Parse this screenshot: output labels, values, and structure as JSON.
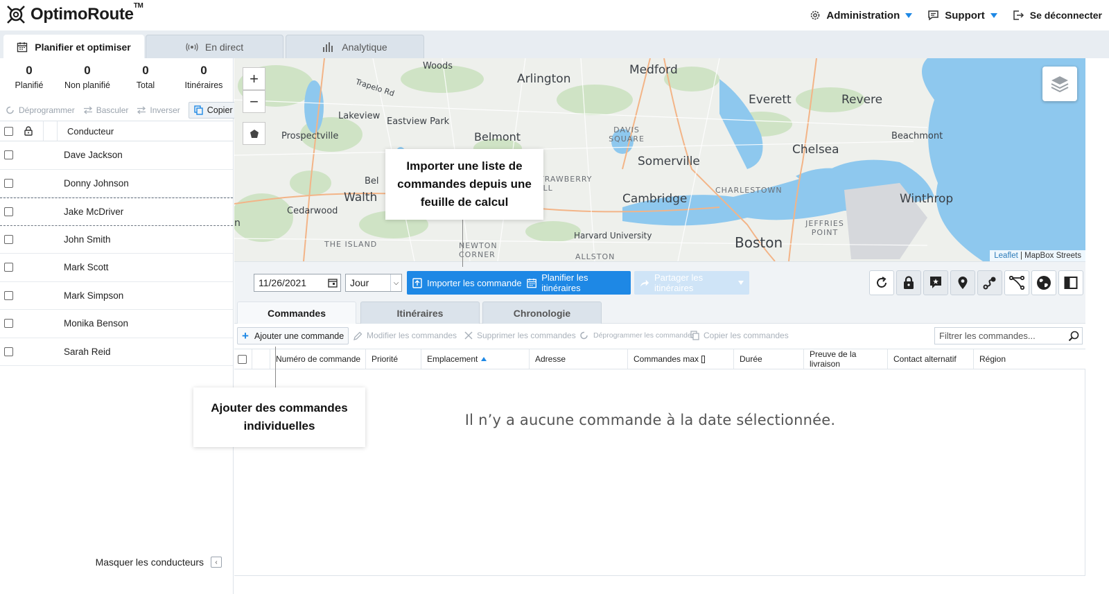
{
  "app": {
    "logo_text": "OptimoRoute",
    "logo_tm": "TM",
    "top_nav": [
      {
        "label": "Administration",
        "icon": "gear-icon",
        "dropdown": true
      },
      {
        "label": "Support",
        "icon": "chat-icon",
        "dropdown": true
      },
      {
        "label": "Se déconnecter",
        "icon": "logout-icon",
        "dropdown": false
      }
    ],
    "accent_color": "#1e88e5"
  },
  "main_tabs": [
    {
      "label": "Planifier et optimiser",
      "icon": "calendar-icon",
      "active": true
    },
    {
      "label": "En direct",
      "icon": "broadcast-icon",
      "active": false
    },
    {
      "label": "Analytique",
      "icon": "bar-chart-icon",
      "active": false
    }
  ],
  "stats": [
    {
      "value": "0",
      "label": "Planifié"
    },
    {
      "value": "0",
      "label": "Non planifié"
    },
    {
      "value": "0",
      "label": "Total"
    },
    {
      "value": "0",
      "label": "Itinéraires"
    }
  ],
  "driver_actions": {
    "unschedule": "Déprogrammer",
    "switch": "Basculer",
    "reverse": "Inverser",
    "copy": "Copier"
  },
  "drivers": {
    "column_header": "Conducteur",
    "items": [
      "Dave Jackson",
      "Donny Johnson",
      "Jake McDriver",
      "John Smith",
      "Mark Scott",
      "Mark Simpson",
      "Monika Benson",
      "Sarah Reid"
    ],
    "hide_label": "Masquer les conducteurs"
  },
  "map": {
    "labels": [
      "Arlington",
      "Medford",
      "Everett",
      "Revere",
      "Woods",
      "Lakeview",
      "Eastview Park",
      "Belmont",
      "Prospectville",
      "DAVIS SQUARE",
      "Somerville",
      "Chelsea",
      "Beachmont",
      "Walth",
      "Cedarwood",
      "STRAWBERRY HILL",
      "Cambridge",
      "CHARLESTOWN",
      "Winthrop",
      "JEFFRIES POINT",
      "Harvard University",
      "Boston",
      "THE ISLAND",
      "NEWTON CORNER",
      "ALLSTON",
      "Trapelo Rd",
      "Bel",
      "n"
    ],
    "attribution_link": "Leaflet",
    "attribution_text": "| MapBox Streets",
    "zoom_in": "+",
    "zoom_out": "−"
  },
  "toolbar": {
    "date": "11/26/2021",
    "view": "Jour",
    "import_label": "Importer les commandes",
    "plan_label": "Planifier les itinéraires",
    "share_label": "Partager les itinéraires"
  },
  "sub_tabs": [
    {
      "label": "Commandes",
      "active": true
    },
    {
      "label": "Itinéraires",
      "active": false
    },
    {
      "label": "Chronologie",
      "active": false
    }
  ],
  "orders_toolbar": {
    "add": "Ajouter une commande",
    "edit": "Modifier les commandes",
    "delete": "Supprimer les commandes",
    "unschedule": "Déprogrammer les commandes",
    "copy": "Copier les commandes",
    "filter_placeholder": "Filtrer les commandes..."
  },
  "orders_table": {
    "columns": [
      "Numéro de commande",
      "Priorité",
      "Emplacement",
      "Adresse",
      "Commandes max",
      "Durée",
      "Preuve de la livraison",
      "Contact alternatif",
      "Région"
    ],
    "empty_message": "Il n’y a aucune commande à la date sélectionnée."
  },
  "callouts": {
    "import": "Importer une liste de commandes depuis une feuille de calcul",
    "add": "Ajouter des commandes individuelles"
  }
}
